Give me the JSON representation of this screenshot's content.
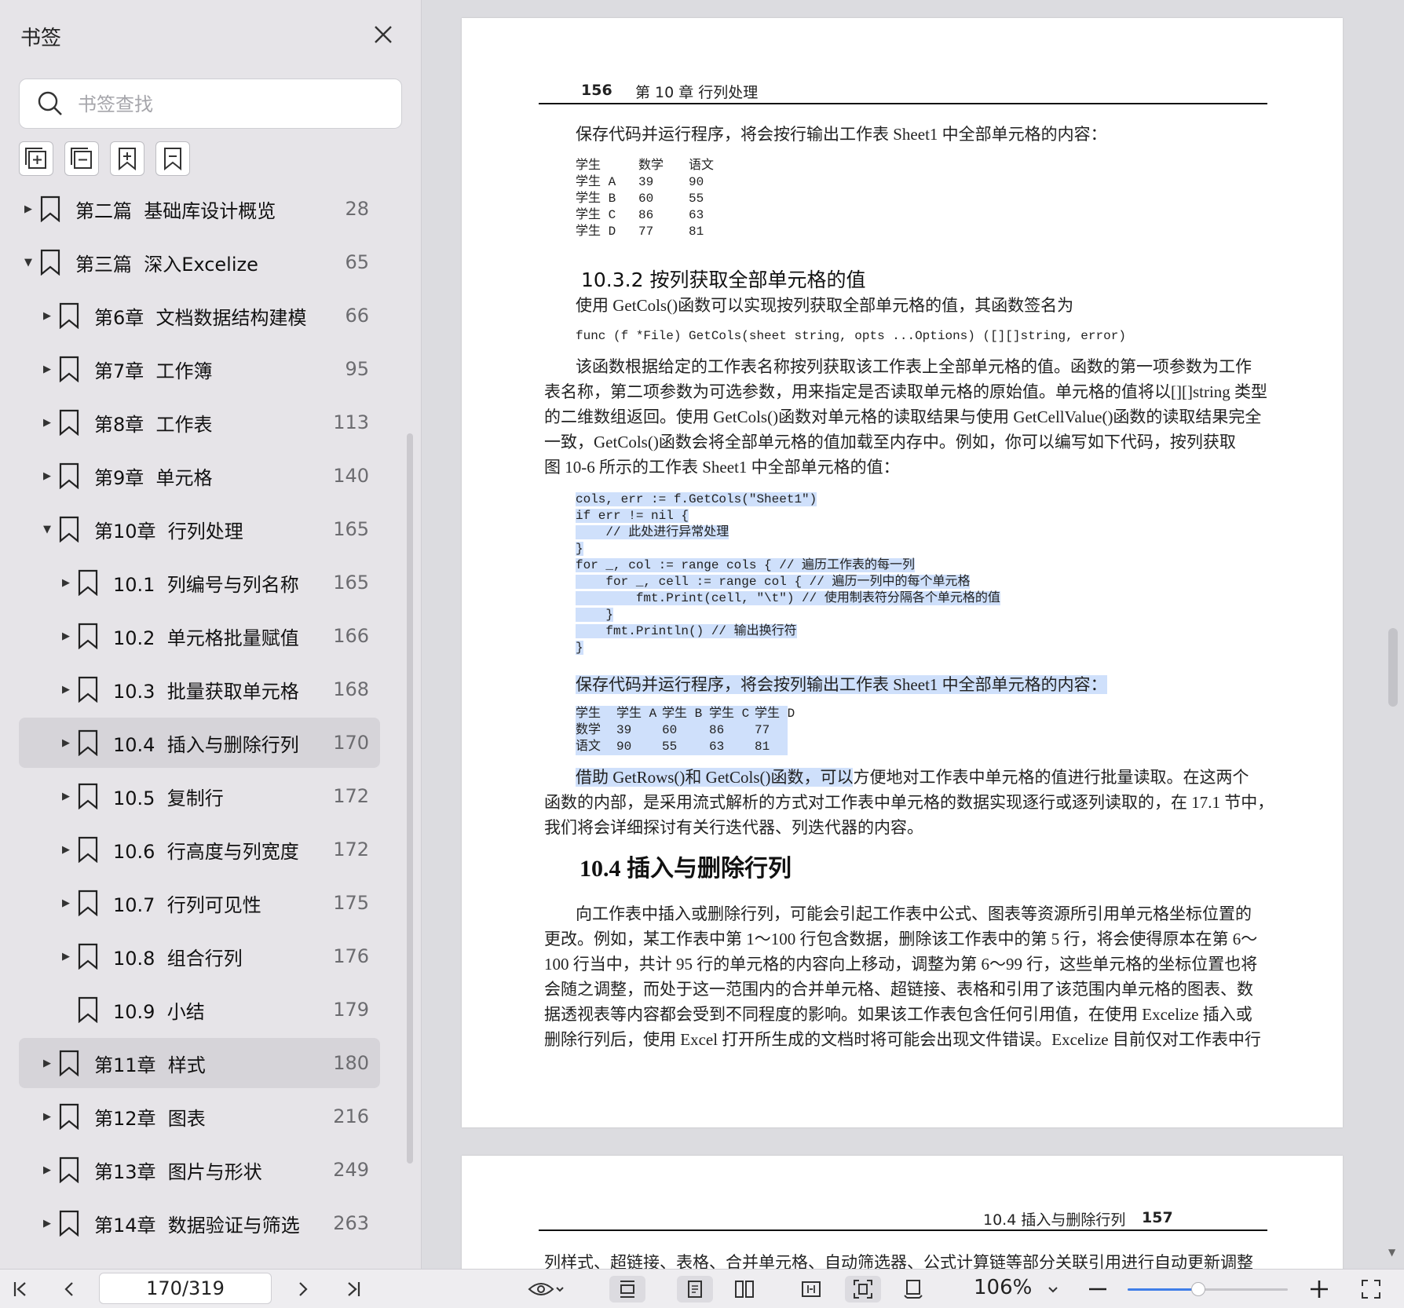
{
  "sidebar": {
    "title": "书签",
    "search_placeholder": "书签查找",
    "items": [
      {
        "label": "第二篇  基础库设计概览",
        "page": "28",
        "level": 0,
        "expanded": false,
        "has_children": true,
        "selected": false
      },
      {
        "label": "第三篇  深入Excelize",
        "page": "65",
        "level": 0,
        "expanded": true,
        "has_children": true,
        "selected": false
      },
      {
        "label": "第6章  文档数据结构建模",
        "page": "66",
        "level": 1,
        "expanded": false,
        "has_children": true,
        "selected": false
      },
      {
        "label": "第7章  工作簿",
        "page": "95",
        "level": 1,
        "expanded": false,
        "has_children": true,
        "selected": false
      },
      {
        "label": "第8章  工作表",
        "page": "113",
        "level": 1,
        "expanded": false,
        "has_children": true,
        "selected": false
      },
      {
        "label": "第9章  单元格",
        "page": "140",
        "level": 1,
        "expanded": false,
        "has_children": true,
        "selected": false
      },
      {
        "label": "第10章  行列处理",
        "page": "165",
        "level": 1,
        "expanded": true,
        "has_children": true,
        "selected": false
      },
      {
        "label": "10.1  列编号与列名称",
        "page": "165",
        "level": 2,
        "expanded": false,
        "has_children": true,
        "selected": false
      },
      {
        "label": "10.2  单元格批量赋值",
        "page": "166",
        "level": 2,
        "expanded": false,
        "has_children": true,
        "selected": false
      },
      {
        "label": "10.3  批量获取单元格",
        "page": "168",
        "level": 2,
        "expanded": false,
        "has_children": true,
        "selected": false
      },
      {
        "label": "10.4  插入与删除行列",
        "page": "170",
        "level": 2,
        "expanded": false,
        "has_children": true,
        "selected": true
      },
      {
        "label": "10.5  复制行",
        "page": "172",
        "level": 2,
        "expanded": false,
        "has_children": true,
        "selected": false
      },
      {
        "label": "10.6  行高度与列宽度",
        "page": "172",
        "level": 2,
        "expanded": false,
        "has_children": true,
        "selected": false
      },
      {
        "label": "10.7  行列可见性",
        "page": "175",
        "level": 2,
        "expanded": false,
        "has_children": true,
        "selected": false
      },
      {
        "label": "10.8  组合行列",
        "page": "176",
        "level": 2,
        "expanded": false,
        "has_children": true,
        "selected": false
      },
      {
        "label": "10.9  小结",
        "page": "179",
        "level": 2,
        "expanded": false,
        "has_children": false,
        "selected": false
      },
      {
        "label": "第11章  样式",
        "page": "180",
        "level": 1,
        "expanded": false,
        "has_children": true,
        "selected": true
      },
      {
        "label": "第12章  图表",
        "page": "216",
        "level": 1,
        "expanded": false,
        "has_children": true,
        "selected": false
      },
      {
        "label": "第13章  图片与形状",
        "page": "249",
        "level": 1,
        "expanded": false,
        "has_children": true,
        "selected": false
      },
      {
        "label": "第14章  数据验证与筛选",
        "page": "263",
        "level": 1,
        "expanded": false,
        "has_children": true,
        "selected": false
      }
    ]
  },
  "page1": {
    "header_num": "156",
    "header_text": "第 10 章   行列处理",
    "intro": "保存代码并运行程序，将会按行输出工作表 Sheet1 中全部单元格的内容：",
    "table1": {
      "headers": [
        "学生",
        "数学",
        "语文"
      ],
      "rows": [
        [
          "学生 A",
          "39",
          "90"
        ],
        [
          "学生 B",
          "60",
          "55"
        ],
        [
          "学生 C",
          "86",
          "63"
        ],
        [
          "学生 D",
          "77",
          "81"
        ]
      ]
    },
    "h_10_3_2": "10.3.2   按列获取全部单元格的值",
    "p_getcols": "使用 GetCols()函数可以实现按列获取全部单元格的值，其函数签名为",
    "func_sig": "func (f *File) GetCols(sheet string, opts ...Options) ([][]string, error)",
    "para1": [
      "该函数根据给定的工作表名称按列获取该工作表上全部单元格的值。函数的第一项参数为工作",
      "表名称，第二项参数为可选参数，用来指定是否读取单元格的原始值。单元格的值将以[][]string 类型",
      "的二维数组返回。使用 GetCols()函数对单元格的读取结果与使用 GetCellValue()函数的读取结果完全",
      "一致，GetCols()函数会将全部单元格的值加载至内存中。例如，你可以编写如下代码，按列获取",
      "图 10-6 所示的工作表 Sheet1 中全部单元格的值："
    ],
    "code": [
      "cols, err := f.GetCols(\"Sheet1\")",
      "if err != nil {",
      "    // 此处进行异常处理",
      "}",
      "for _, col := range cols { // 遍历工作表的每一列",
      "    for _, cell := range col { // 遍历一列中的每个单元格",
      "        fmt.Print(cell, \"\\t\") // 使用制表符分隔各个单元格的值",
      "    }",
      "    fmt.Println() // 输出换行符",
      "}"
    ],
    "p_save2": "保存代码并运行程序，将会按列输出工作表 Sheet1 中全部单元格的内容：",
    "table2": {
      "headers": [
        "学生",
        "学生 A",
        "学生 B",
        "学生 C",
        "学生 D"
      ],
      "rows": [
        [
          "数学",
          "39",
          "60",
          "86",
          "77"
        ],
        [
          "语文",
          "90",
          "55",
          "63",
          "81"
        ]
      ]
    },
    "para2_highlight": "借助 GetRows()和 GetCols()函数，可以",
    "para2_line1_rest": "方便地对工作表中单元格的值进行批量读取。在这两个",
    "para2_rest": [
      "函数的内部，是采用流式解析的方式对工作表中单元格的数据实现逐行或逐列读取的，在 17.1 节中，",
      "我们将会详细探讨有关行迭代器、列迭代器的内容。"
    ],
    "h_10_4": "10.4   插入与删除行列",
    "para3": [
      "向工作表中插入或删除行列，可能会引起工作表中公式、图表等资源所引用单元格坐标位置的",
      "更改。例如，某工作表中第 1～100 行包含数据，删除该工作表中的第 5 行，将会使得原本在第 6～",
      "100 行当中，共计 95 行的单元格的内容向上移动，调整为第 6～99 行，这些单元格的坐标位置也将",
      "会随之调整，而处于这一范围内的合并单元格、超链接、表格和引用了该范围内单元格的图表、数",
      "据透视表等内容都会受到不同程度的影响。如果该工作表包含任何引用值，在使用 Excelize 插入或",
      "删除行列后，使用 Excel 打开所生成的文档时将可能会出现文件错误。Excelize 目前仅对工作表中行"
    ]
  },
  "page2": {
    "header_text": "10.4   插入与删除行列",
    "header_num": "157",
    "partial_line": "列样式、超链接、表格、合并单元格、自动筛选器、公式计算链等部分关联引用进行自动更新调整"
  },
  "bottombar": {
    "page_indicator": "170/319",
    "zoom": "106%",
    "zoom_fraction": 0.44
  },
  "colors": {
    "sidebar_bg": "#e6e4e8",
    "selected_bg": "#d6d4d9",
    "highlight": "#cfe0fb",
    "accent": "#3f7ee8"
  }
}
